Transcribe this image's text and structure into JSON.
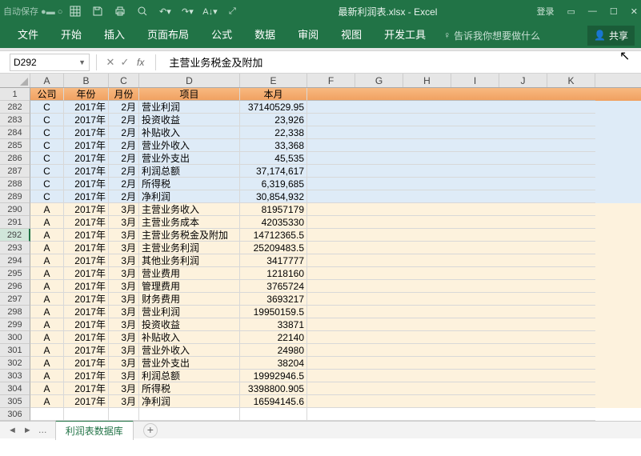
{
  "titlebar": {
    "autosave": "自动保存 ●▬ ○",
    "filename": "最新利润表.xlsx - Excel",
    "login": "登录"
  },
  "ribbon": {
    "tabs": [
      "文件",
      "开始",
      "插入",
      "页面布局",
      "公式",
      "数据",
      "审阅",
      "视图",
      "开发工具"
    ],
    "tell": "告诉我你想要做什么",
    "share": "共享"
  },
  "namebox": "D292",
  "formula": "主营业务税金及附加",
  "colHeaders": [
    "A",
    "B",
    "C",
    "D",
    "E",
    "F",
    "G",
    "H",
    "I",
    "J",
    "K"
  ],
  "headerRow": {
    "num": "1",
    "a": "公司",
    "b": "年份",
    "c": "月份",
    "d": "项目",
    "e": "本月"
  },
  "rows": [
    {
      "n": "282",
      "a": "C",
      "b": "2017年",
      "c": "2月",
      "d": "营业利润",
      "e": "37140529.95",
      "bg": "blue"
    },
    {
      "n": "283",
      "a": "C",
      "b": "2017年",
      "c": "2月",
      "d": "投资收益",
      "e": "23,926",
      "bg": "blue"
    },
    {
      "n": "284",
      "a": "C",
      "b": "2017年",
      "c": "2月",
      "d": "补贴收入",
      "e": "22,338",
      "bg": "blue"
    },
    {
      "n": "285",
      "a": "C",
      "b": "2017年",
      "c": "2月",
      "d": "营业外收入",
      "e": "33,368",
      "bg": "blue"
    },
    {
      "n": "286",
      "a": "C",
      "b": "2017年",
      "c": "2月",
      "d": "营业外支出",
      "e": "45,535",
      "bg": "blue"
    },
    {
      "n": "287",
      "a": "C",
      "b": "2017年",
      "c": "2月",
      "d": "利润总额",
      "e": "37,174,617",
      "bg": "blue"
    },
    {
      "n": "288",
      "a": "C",
      "b": "2017年",
      "c": "2月",
      "d": "所得税",
      "e": "6,319,685",
      "bg": "blue"
    },
    {
      "n": "289",
      "a": "C",
      "b": "2017年",
      "c": "2月",
      "d": "净利润",
      "e": "30,854,932",
      "bg": "blue"
    },
    {
      "n": "290",
      "a": "A",
      "b": "2017年",
      "c": "3月",
      "d": "主营业务收入",
      "e": "81957179",
      "bg": "yel"
    },
    {
      "n": "291",
      "a": "A",
      "b": "2017年",
      "c": "3月",
      "d": "主营业务成本",
      "e": "42035330",
      "bg": "yel"
    },
    {
      "n": "292",
      "a": "A",
      "b": "2017年",
      "c": "3月",
      "d": "主营业务税金及附加",
      "e": "14712365.5",
      "bg": "yel",
      "sel": true
    },
    {
      "n": "293",
      "a": "A",
      "b": "2017年",
      "c": "3月",
      "d": "主营业务利润",
      "e": "25209483.5",
      "bg": "yel"
    },
    {
      "n": "294",
      "a": "A",
      "b": "2017年",
      "c": "3月",
      "d": "其他业务利润",
      "e": "3417777",
      "bg": "yel"
    },
    {
      "n": "295",
      "a": "A",
      "b": "2017年",
      "c": "3月",
      "d": "营业费用",
      "e": "1218160",
      "bg": "yel"
    },
    {
      "n": "296",
      "a": "A",
      "b": "2017年",
      "c": "3月",
      "d": "管理费用",
      "e": "3765724",
      "bg": "yel"
    },
    {
      "n": "297",
      "a": "A",
      "b": "2017年",
      "c": "3月",
      "d": "财务费用",
      "e": "3693217",
      "bg": "yel"
    },
    {
      "n": "298",
      "a": "A",
      "b": "2017年",
      "c": "3月",
      "d": "营业利润",
      "e": "19950159.5",
      "bg": "yel"
    },
    {
      "n": "299",
      "a": "A",
      "b": "2017年",
      "c": "3月",
      "d": "投资收益",
      "e": "33871",
      "bg": "yel"
    },
    {
      "n": "300",
      "a": "A",
      "b": "2017年",
      "c": "3月",
      "d": "补贴收入",
      "e": "22140",
      "bg": "yel"
    },
    {
      "n": "301",
      "a": "A",
      "b": "2017年",
      "c": "3月",
      "d": "营业外收入",
      "e": "24980",
      "bg": "yel"
    },
    {
      "n": "302",
      "a": "A",
      "b": "2017年",
      "c": "3月",
      "d": "营业外支出",
      "e": "38204",
      "bg": "yel"
    },
    {
      "n": "303",
      "a": "A",
      "b": "2017年",
      "c": "3月",
      "d": "利润总额",
      "e": "19992946.5",
      "bg": "yel"
    },
    {
      "n": "304",
      "a": "A",
      "b": "2017年",
      "c": "3月",
      "d": "所得税",
      "e": "3398800.905",
      "bg": "yel"
    },
    {
      "n": "305",
      "a": "A",
      "b": "2017年",
      "c": "3月",
      "d": "净利润",
      "e": "16594145.6",
      "bg": "yel"
    },
    {
      "n": "306",
      "a": "",
      "b": "",
      "c": "",
      "d": "",
      "e": "",
      "bg": ""
    }
  ],
  "sheetTab": "利润表数据库"
}
